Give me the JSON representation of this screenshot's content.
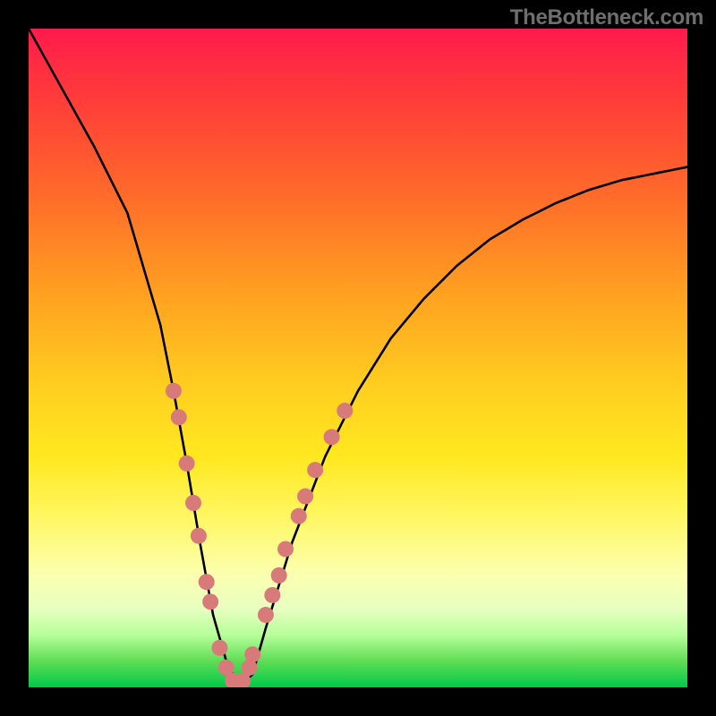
{
  "watermark": "TheBottleneck.com",
  "chart_data": {
    "type": "line",
    "title": "",
    "xlabel": "",
    "ylabel": "",
    "xlim": [
      0,
      100
    ],
    "ylim": [
      0,
      100
    ],
    "grid": false,
    "series": [
      {
        "name": "bottleneck-curve",
        "x": [
          0,
          5,
          10,
          15,
          20,
          22,
          24,
          26,
          28,
          30,
          32,
          34,
          36,
          40,
          45,
          50,
          55,
          60,
          65,
          70,
          75,
          80,
          85,
          90,
          95,
          100
        ],
        "values": [
          100,
          91,
          82,
          72,
          55,
          45,
          34,
          22,
          11,
          4,
          0,
          2,
          9,
          22,
          35,
          45,
          53,
          59,
          64,
          68,
          71,
          73.5,
          75.5,
          77,
          78,
          79
        ],
        "color": "#000000"
      }
    ],
    "markers": {
      "name": "sample-points",
      "color": "#d97a7a",
      "radius_px": 9,
      "points": [
        {
          "x": 22,
          "y": 45
        },
        {
          "x": 22.8,
          "y": 41
        },
        {
          "x": 24,
          "y": 34
        },
        {
          "x": 25,
          "y": 28
        },
        {
          "x": 25.8,
          "y": 23
        },
        {
          "x": 27,
          "y": 16
        },
        {
          "x": 27.6,
          "y": 13
        },
        {
          "x": 29,
          "y": 6
        },
        {
          "x": 30,
          "y": 3
        },
        {
          "x": 31,
          "y": 1
        },
        {
          "x": 32.5,
          "y": 1
        },
        {
          "x": 33.5,
          "y": 3
        },
        {
          "x": 34,
          "y": 5
        },
        {
          "x": 36,
          "y": 11
        },
        {
          "x": 37,
          "y": 14
        },
        {
          "x": 38,
          "y": 17
        },
        {
          "x": 39,
          "y": 21
        },
        {
          "x": 41,
          "y": 26
        },
        {
          "x": 42,
          "y": 29
        },
        {
          "x": 43.5,
          "y": 33
        },
        {
          "x": 46,
          "y": 38
        },
        {
          "x": 48,
          "y": 42
        }
      ]
    }
  }
}
